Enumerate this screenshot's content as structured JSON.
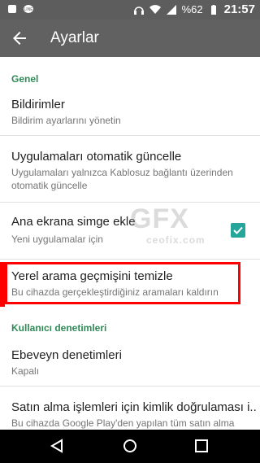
{
  "status_bar": {
    "battery": "%62",
    "time": "21:57",
    "icons": [
      "notification-icon",
      "line-app-icon",
      "headset-icon",
      "wifi-icon",
      "signal-icon",
      "battery-icon"
    ]
  },
  "app_bar": {
    "title": "Ayarlar",
    "back_icon": "arrow-left-icon"
  },
  "sections": {
    "general_header": "Genel",
    "user_controls_header": "Kullanıcı denetimleri"
  },
  "items": {
    "notifications": {
      "title": "Bildirimler",
      "subtitle": "Bildirim ayarlarını yönetin"
    },
    "auto_update": {
      "title": "Uygulamaları otomatik güncelle",
      "subtitle": "Uygulamaları yalnızca Kablosuz bağlantı üzerinden otomatik güncelle"
    },
    "home_icon": {
      "title": "Ana ekrana simge ekle",
      "subtitle": "Yeni uygulamalar için",
      "checked": true
    },
    "clear_history": {
      "title": "Yerel arama geçmişini temizle",
      "subtitle": "Bu cihazda gerçekleştirdiğiniz aramaları kaldırın"
    },
    "parental": {
      "title": "Ebeveyn denetimleri",
      "subtitle": "Kapalı"
    },
    "purchase_auth": {
      "title": "Satın alma işlemleri için kimlik doğrulaması i..",
      "subtitle": "Bu cihazda Google Play'den yapılan tüm satın alma"
    }
  },
  "watermark": {
    "logo": "GFX",
    "site": "ceofix.com"
  },
  "colors": {
    "accent": "#26a69a",
    "section": "#2e8b57",
    "highlight": "#ff0000",
    "app_bar": "#616161"
  }
}
